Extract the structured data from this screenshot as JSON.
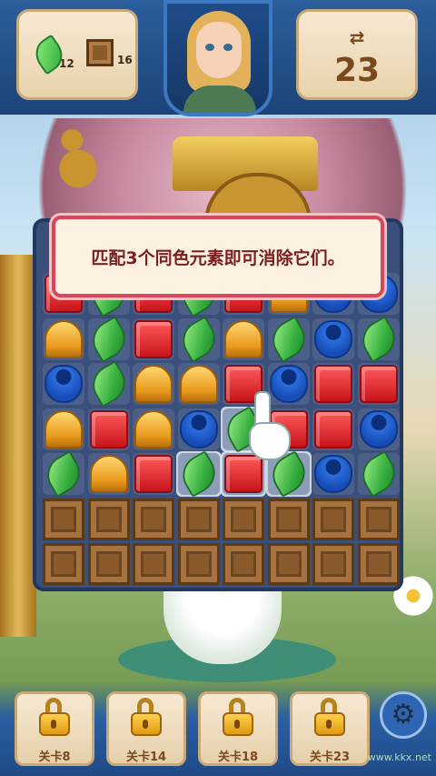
{
  "header": {
    "goals": [
      {
        "icon": "leaf-icon",
        "count": "12"
      },
      {
        "icon": "crate-icon",
        "count": "16"
      }
    ],
    "moves": {
      "icon": "swap-arrows-icon",
      "value": "23"
    }
  },
  "tutorial": {
    "message": "匹配3个同色元素即可消除它们。"
  },
  "board": {
    "columns": 8,
    "rows": [
      [
        "cube",
        "leaf",
        "cube",
        "leaf",
        "cube",
        "bell",
        "pot",
        "pot"
      ],
      [
        "bell",
        "leaf",
        "cube",
        "leaf",
        "bell",
        "leaf",
        "pot",
        "leaf"
      ],
      [
        "pot",
        "leaf",
        "bell",
        "bell",
        "cube",
        "pot",
        "cube",
        "cube"
      ],
      [
        "bell",
        "cube",
        "bell",
        "pot",
        "leaf",
        "cube",
        "cube",
        "pot"
      ],
      [
        "leaf",
        "bell",
        "cube",
        "leaf",
        "cube",
        "leaf",
        "pot",
        "leaf"
      ],
      [
        "crate",
        "crate",
        "crate",
        "crate",
        "crate",
        "crate",
        "crate",
        "crate"
      ],
      [
        "crate",
        "crate",
        "crate",
        "crate",
        "crate",
        "crate",
        "crate",
        "crate"
      ]
    ]
  },
  "levels": [
    {
      "label": "关卡8",
      "icon": "lock-icon"
    },
    {
      "label": "关卡14",
      "icon": "lock-icon"
    },
    {
      "label": "关卡18",
      "icon": "lock-icon"
    },
    {
      "label": "关卡23",
      "icon": "lock-icon"
    }
  ],
  "settings": {
    "icon": "gear-icon",
    "glyph": "⚙"
  },
  "watermark": "www.kkx.net",
  "colors": {
    "accent": "#d9455b",
    "panel": "#f6e9d2",
    "board": "#3a4f7a"
  }
}
